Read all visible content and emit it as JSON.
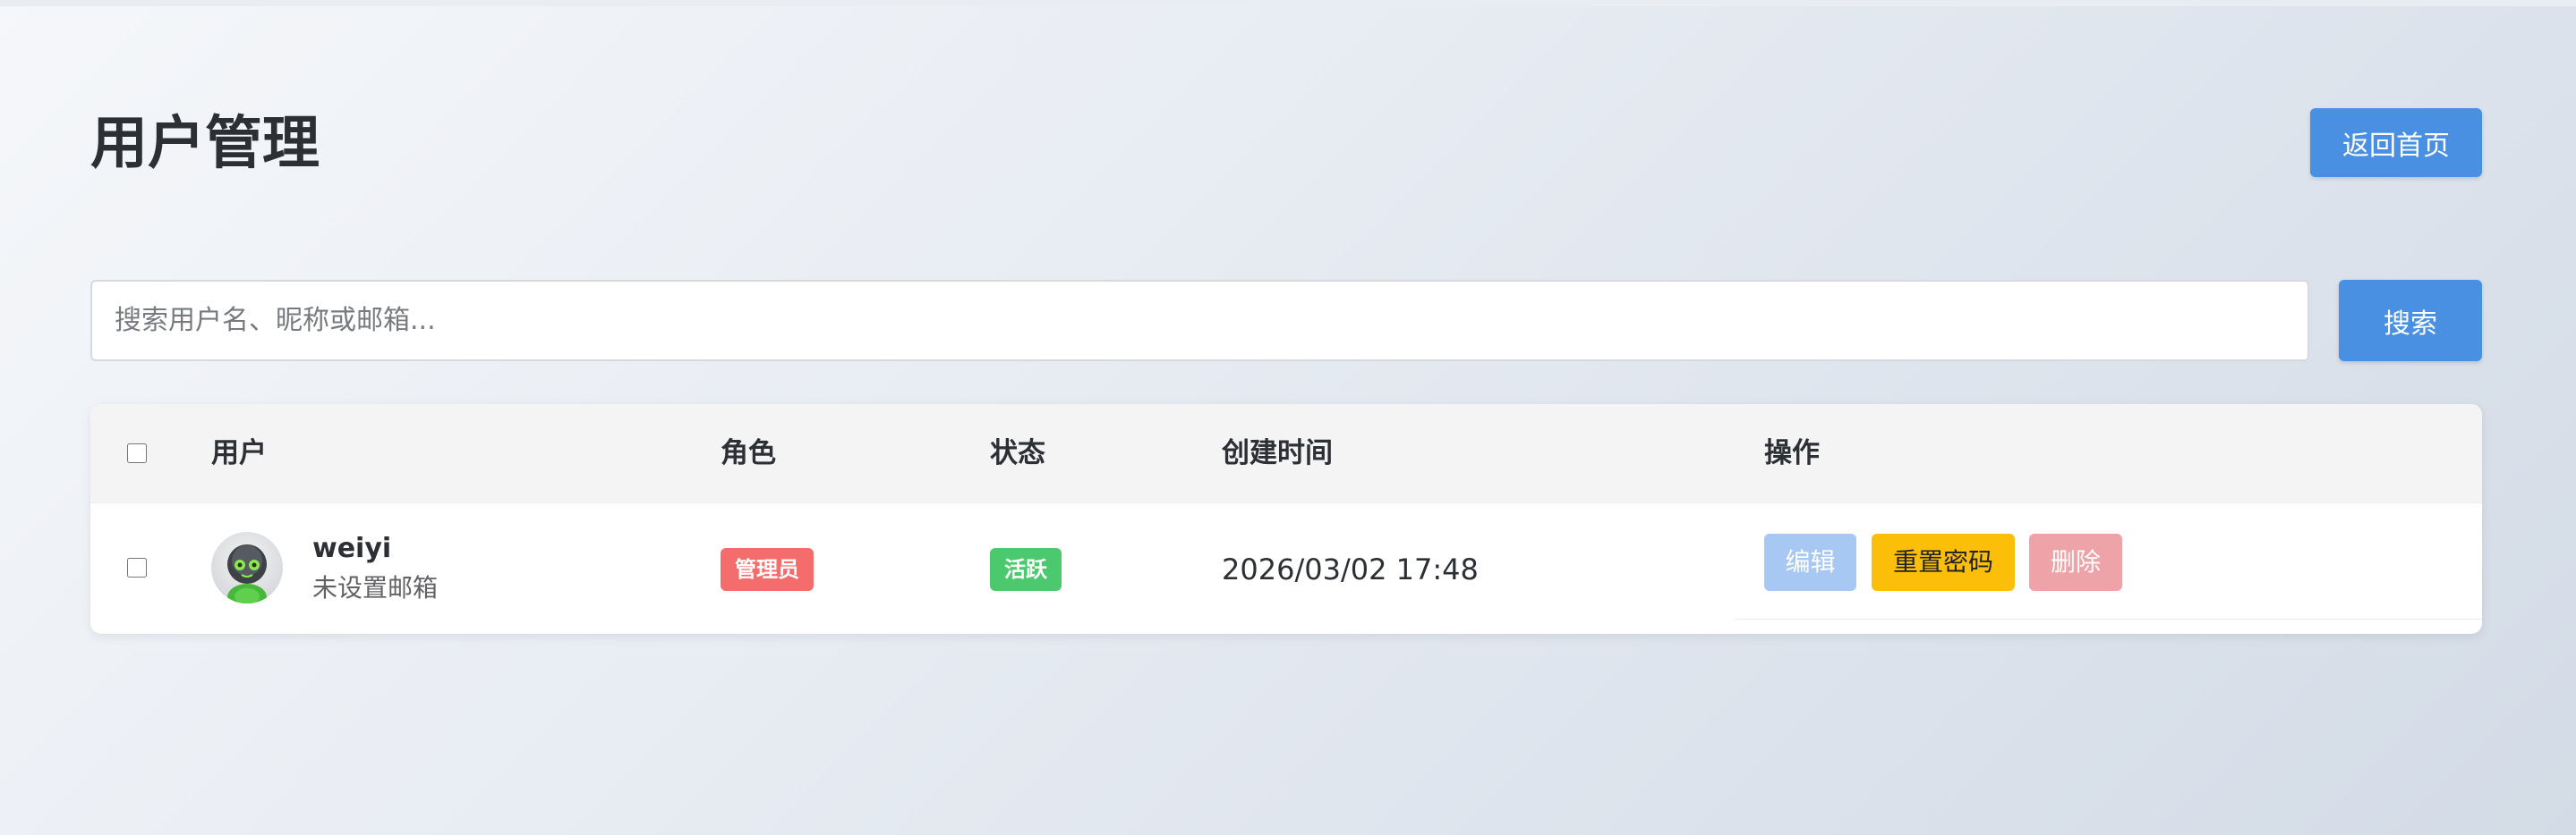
{
  "page": {
    "title": "用户管理",
    "back_button": "返回首页"
  },
  "search": {
    "placeholder": "搜索用户名、昵称或邮箱...",
    "value": "",
    "button": "搜索"
  },
  "table": {
    "columns": {
      "user": "用户",
      "role": "角色",
      "status": "状态",
      "created": "创建时间",
      "actions": "操作"
    },
    "rows": [
      {
        "username": "weiyi",
        "email": "未设置邮箱",
        "role": "管理员",
        "status": "活跃",
        "created": "2026/03/02 17:48",
        "actions": {
          "edit": "编辑",
          "reset_password": "重置密码",
          "delete": "删除"
        }
      }
    ]
  },
  "colors": {
    "primary": "#4a90e2",
    "admin_badge": "#f56c6c",
    "active_badge": "#4cc96f",
    "edit": "#a6c8f2",
    "reset": "#fcbf09",
    "delete": "#eda3a8"
  },
  "icons": {
    "avatar": "robot-avatar"
  }
}
